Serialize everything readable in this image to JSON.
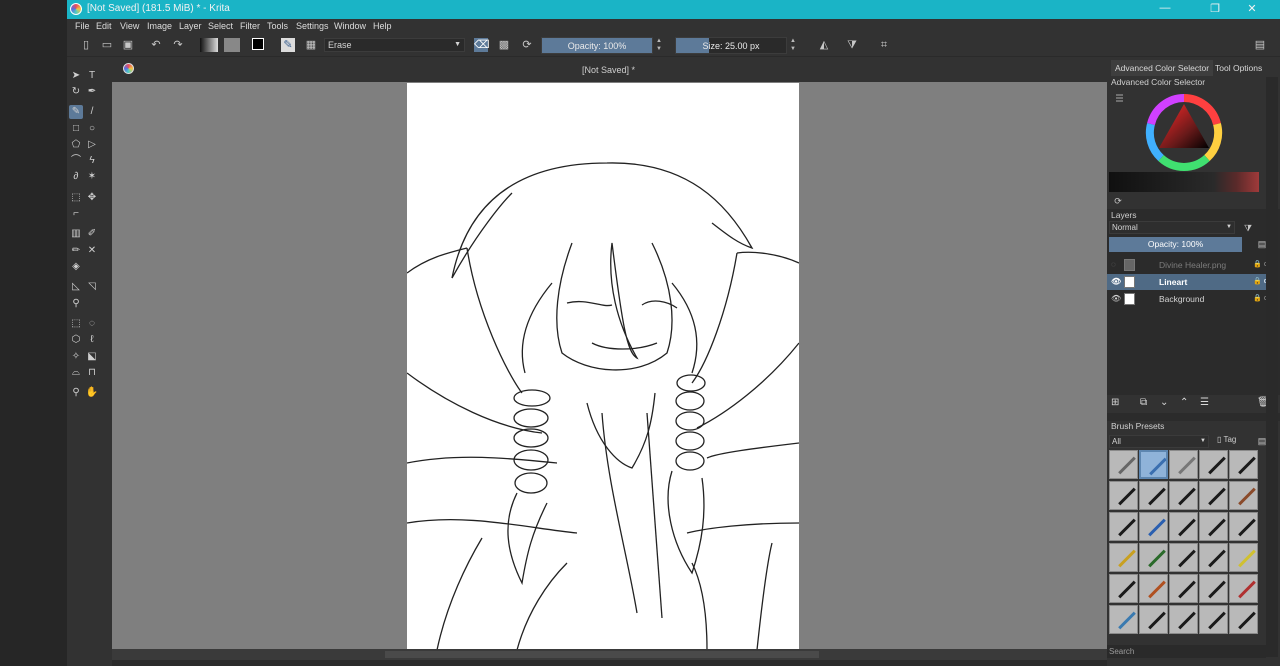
{
  "window": {
    "title": "[Not Saved]  (181.5 MiB)  * - Krita",
    "controls": [
      "—",
      "❐",
      "✕"
    ]
  },
  "menu": [
    "File",
    "Edit",
    "View",
    "Image",
    "Layer",
    "Select",
    "Filter",
    "Tools",
    "Settings",
    "Window",
    "Help"
  ],
  "toolbar": {
    "brush_preset": "Erase",
    "opacity": "Opacity: 100%",
    "opacity_level": 1.0,
    "size": "Size: 25.00 px",
    "size_level": 0.3
  },
  "document": {
    "tab_title": "[Not Saved]  *"
  },
  "dock": {
    "tabs": [
      "Advanced Color Selector",
      "Tool Options"
    ],
    "color_selector_title": "Advanced Color Selector",
    "layers_title": "Layers",
    "blend_mode": "Normal",
    "layer_opacity": "Opacity:  100%",
    "layers": [
      {
        "name": "Divine Healer.png",
        "visible": false,
        "selected": false
      },
      {
        "name": "Lineart",
        "visible": true,
        "selected": true
      },
      {
        "name": "Background",
        "visible": true,
        "selected": false
      }
    ],
    "brush_presets_title": "Brush Presets",
    "brush_filter": "All",
    "tag_label": "Tag",
    "search_placeholder": "Search"
  },
  "colors": {
    "accent": "#1ab4c6",
    "selection": "#5d7a99"
  }
}
